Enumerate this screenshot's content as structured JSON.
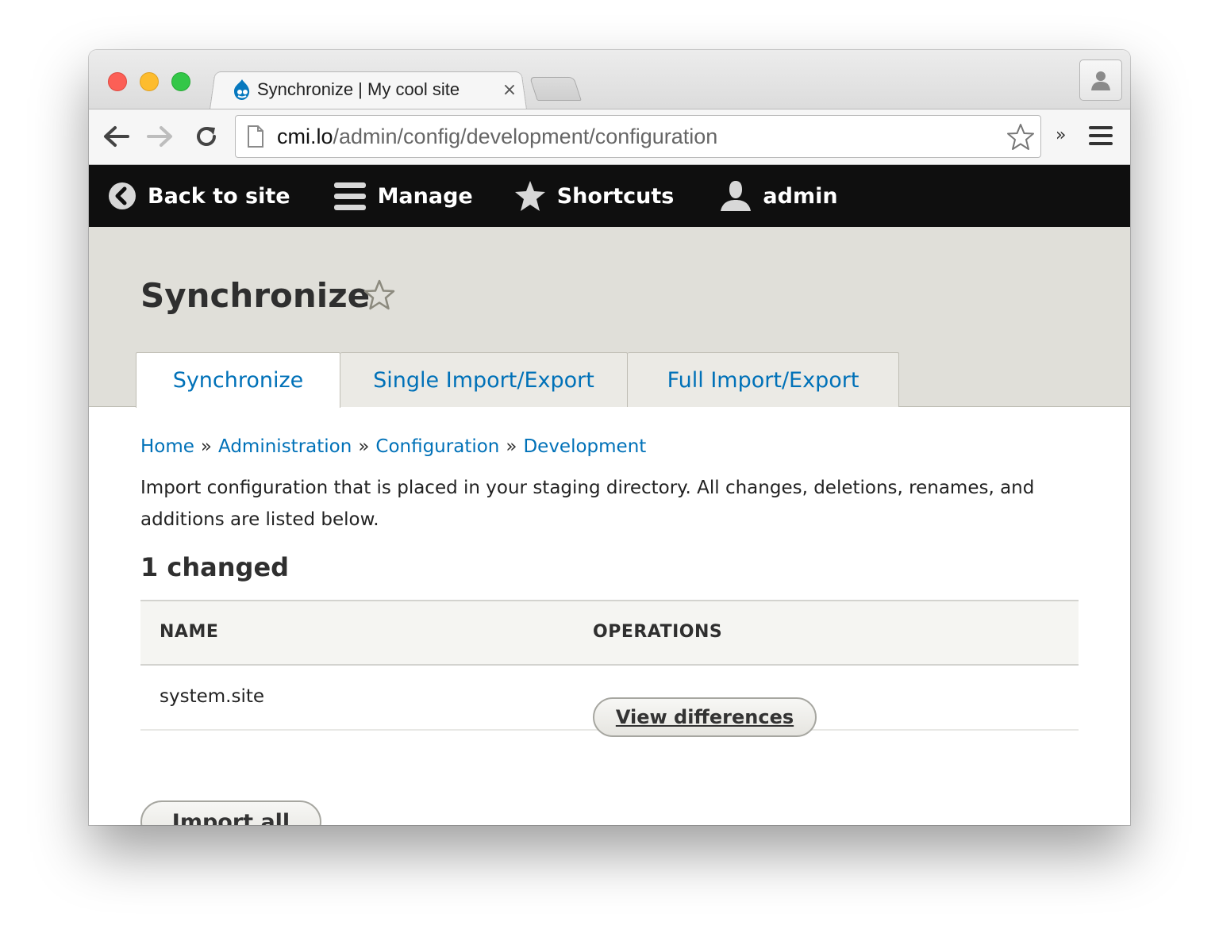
{
  "browser": {
    "tab_title": "Synchronize | My cool site",
    "tab_close": "×",
    "url_host": "cmi.lo",
    "url_path": "/admin/config/development/configuration",
    "overflow": "»"
  },
  "admin_toolbar": {
    "items": [
      {
        "label": "Back to site",
        "icon": "chevron-left-circle-icon"
      },
      {
        "label": "Manage",
        "icon": "hamburger-icon"
      },
      {
        "label": "Shortcuts",
        "icon": "star-icon"
      },
      {
        "label": "admin",
        "icon": "user-icon"
      }
    ]
  },
  "page": {
    "title": "Synchronize",
    "tabs": [
      {
        "label": "Synchronize",
        "active": true
      },
      {
        "label": "Single Import/Export",
        "active": false
      },
      {
        "label": "Full Import/Export",
        "active": false
      }
    ]
  },
  "breadcrumb": {
    "items": [
      "Home",
      "Administration",
      "Configuration",
      "Development"
    ],
    "separator": "»"
  },
  "description": "Import configuration that is placed in your staging directory. All changes, deletions, renames, and additions are listed below.",
  "changes": {
    "heading": "1 changed",
    "columns": [
      "NAME",
      "OPERATIONS"
    ],
    "rows": [
      {
        "name": "system.site",
        "operation": "View differences"
      }
    ]
  },
  "actions": {
    "import_all": "Import all"
  },
  "colors": {
    "link": "#0071b8",
    "admin_bar": "#0f0f0f",
    "header_bg": "#e0dfd9"
  }
}
